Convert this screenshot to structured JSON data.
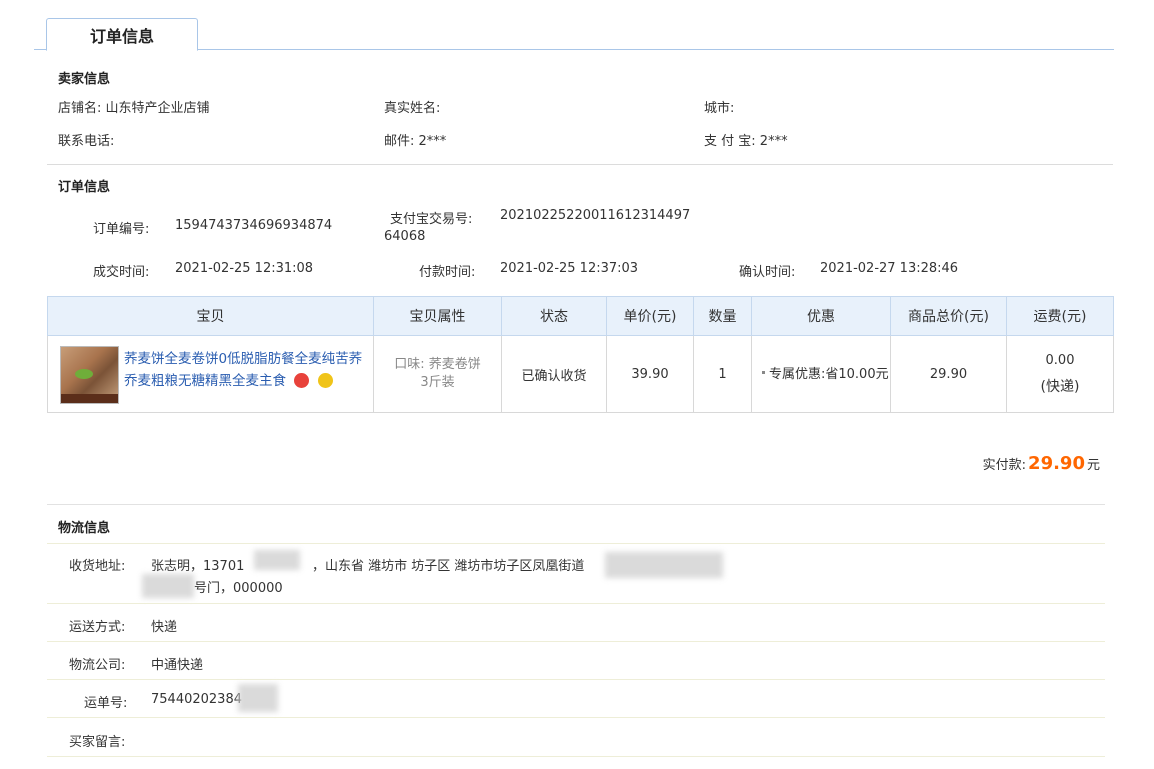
{
  "tab": {
    "label": "订单信息"
  },
  "seller": {
    "title": "卖家信息",
    "shop_label": "店铺名:",
    "shop_value": "山东特产企业店铺",
    "realname_label": "真实姓名:",
    "city_label": "城市:",
    "phone_label": "联系电话:",
    "email_label": "邮件:",
    "email_value": "2***",
    "alipay_label": "支 付 宝:",
    "alipay_value": "2***"
  },
  "order": {
    "title": "订单信息",
    "order_no_label": "订单编号:",
    "order_no": "1594743734696934874",
    "alipay_trade_label": "支付宝交易号:",
    "alipay_trade_line1": "2021022522001161231449​7",
    "alipay_trade_line2": "64068",
    "deal_time_label": "成交时间:",
    "deal_time": "2021-02-25 12:31:08",
    "pay_time_label": "付款时间:",
    "pay_time": "2021-02-25 12:37:03",
    "confirm_time_label": "确认时间:",
    "confirm_time": "2021-02-27 13:28:46"
  },
  "table": {
    "headers": [
      "宝贝",
      "宝贝属性",
      "状态",
      "单价(元)",
      "数量",
      "优惠",
      "商品总价(元)",
      "运费(元)"
    ],
    "row": {
      "product_name": "荞麦饼全麦卷饼0低脱脂肪餐全麦纯苦荞乔麦粗粮无糖精黑全麦主食",
      "attr_line1": "口味: 荞麦卷饼",
      "attr_line2": "3斤装",
      "status": "已确认收货",
      "price": "39.90",
      "qty": "1",
      "promo": "专属优惠:省10.00元",
      "total": "29.90",
      "shipping": "0.00",
      "shipping_method": "(快递)"
    }
  },
  "payment": {
    "label": "实付款:",
    "amount": "29.90",
    "unit": "元"
  },
  "logistics": {
    "title": "物流信息",
    "address_label": "收货地址:",
    "address_line1a": "张志明，13701",
    "address_line1b": "，山东省 潍坊市 坊子区 潍坊市坊子区凤凰街道",
    "address_line2": "号门，000000",
    "method_label": "运送方式:",
    "method": "快递",
    "company_label": "物流公司:",
    "company": "中通快递",
    "waybill_label": "运单号:",
    "waybill": "75440202384",
    "message_label": "买家留言:"
  }
}
